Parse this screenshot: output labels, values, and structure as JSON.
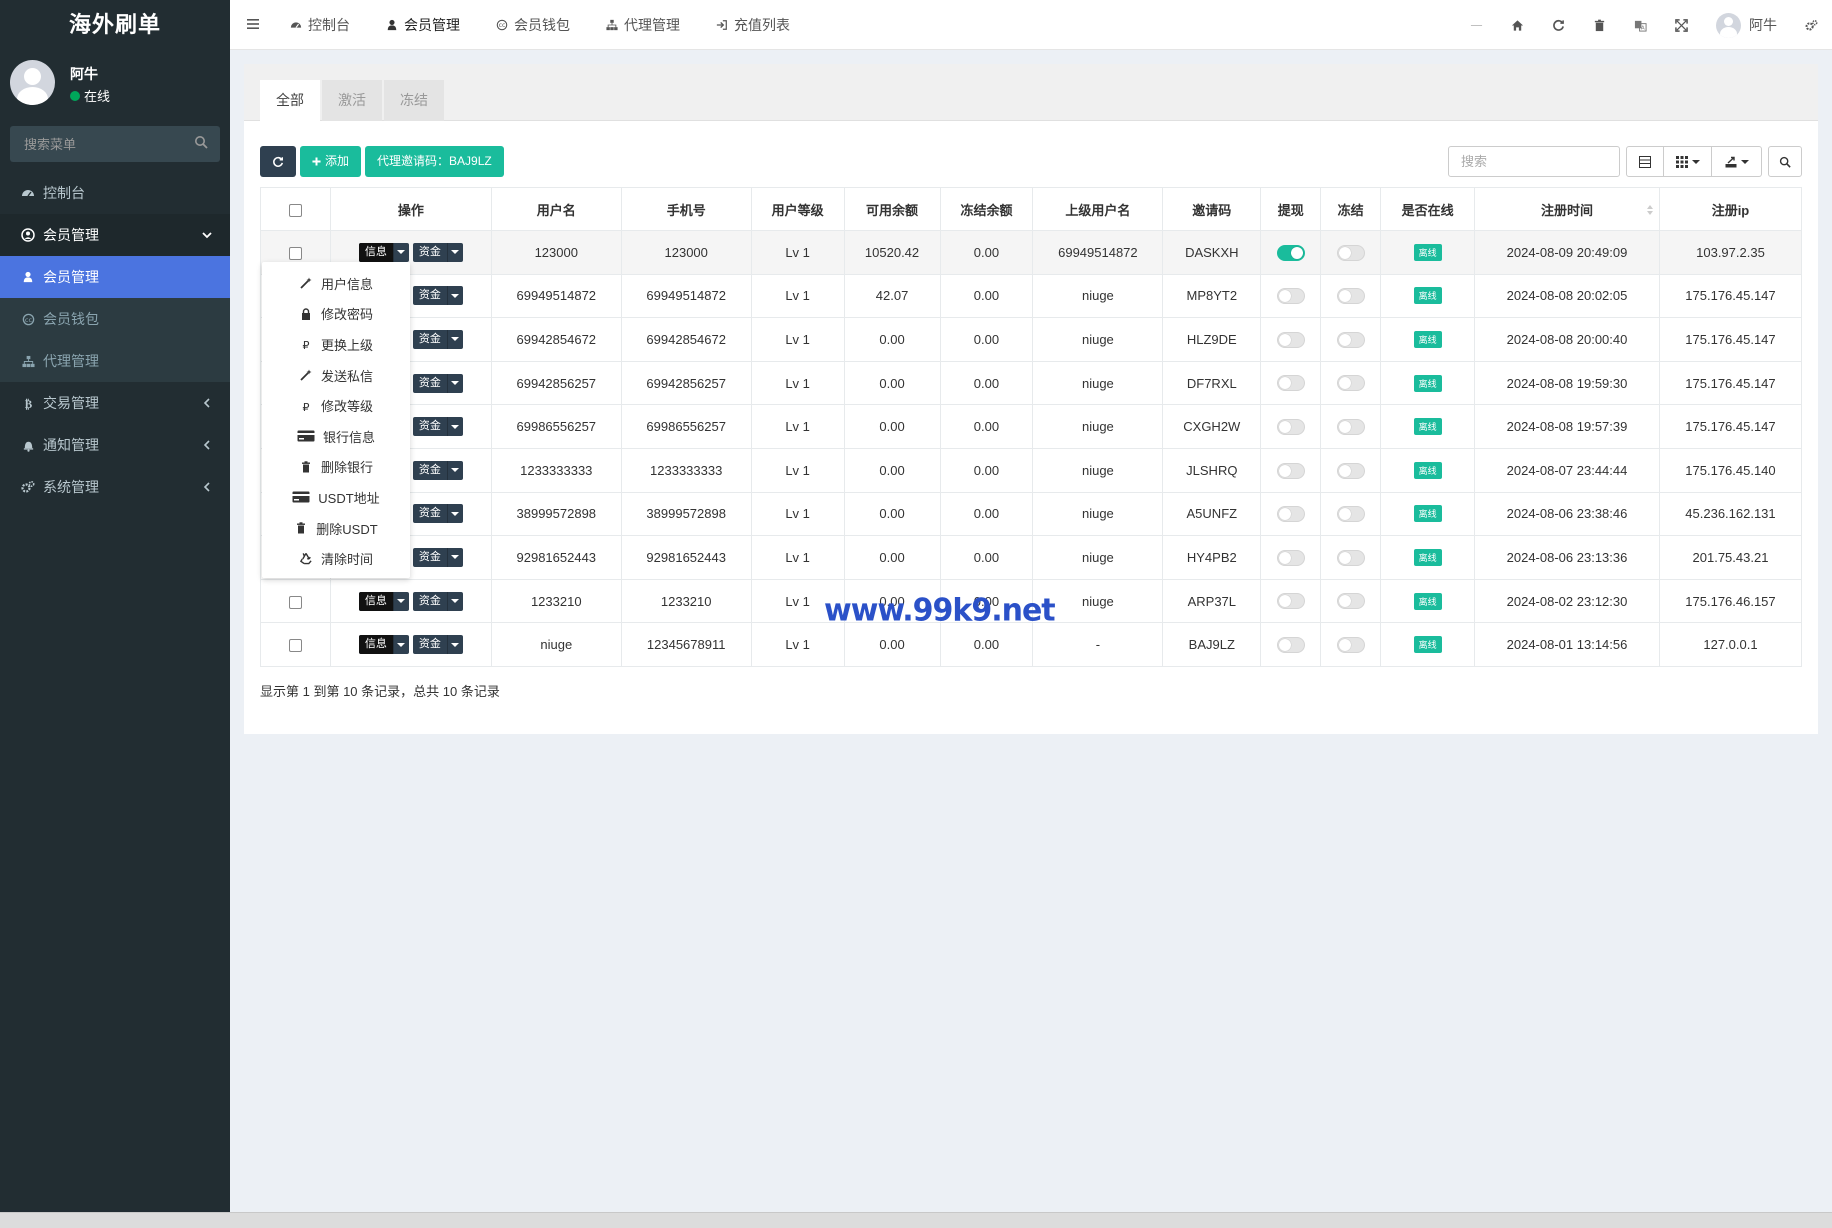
{
  "brand": "海外刷单",
  "user": {
    "name": "阿牛",
    "status": "在线"
  },
  "sidebar": {
    "search_placeholder": "搜索菜单",
    "items": [
      {
        "label": "控制台",
        "icon": "dashboard-icon"
      },
      {
        "label": "会员管理",
        "icon": "user-circle-icon",
        "open": true
      },
      {
        "label": "交易管理",
        "icon": "bitcoin-icon"
      },
      {
        "label": "通知管理",
        "icon": "bell-icon"
      },
      {
        "label": "系统管理",
        "icon": "cogs-icon"
      }
    ],
    "subitems": [
      {
        "label": "会员管理",
        "icon": "user-icon",
        "active": true
      },
      {
        "label": "会员钱包",
        "icon": "wallet-icon"
      },
      {
        "label": "代理管理",
        "icon": "sitemap-icon"
      }
    ]
  },
  "navbar": {
    "tabs": [
      {
        "label": "控制台",
        "icon": "dashboard-icon"
      },
      {
        "label": "会员管理",
        "icon": "user-icon"
      },
      {
        "label": "会员钱包",
        "icon": "wallet-icon"
      },
      {
        "label": "代理管理",
        "icon": "sitemap-icon"
      },
      {
        "label": "充值列表",
        "icon": "sign-in-icon"
      }
    ],
    "user_name": "阿牛"
  },
  "content_tabs": [
    "全部",
    "激活",
    "冻结"
  ],
  "toolbar": {
    "add_label": "添加",
    "invite_label": "代理邀请码：BAJ9LZ",
    "search_placeholder": "搜索"
  },
  "table": {
    "columns": [
      "操作",
      "用户名",
      "手机号",
      "用户等级",
      "可用余额",
      "冻结余额",
      "上级用户名",
      "邀请码",
      "提现",
      "冻结",
      "是否在线",
      "注册时间",
      "注册ip"
    ],
    "info_btn": "信息",
    "funds_btn": "资金",
    "online_badge": "离线",
    "rows": [
      {
        "username": "123000",
        "phone": "123000",
        "level": "Lv 1",
        "balance": "10520.42",
        "frozen": "0.00",
        "parent": "69949514872",
        "invite": "DASKXH",
        "withdraw": true,
        "freeze": false,
        "time": "2024-08-09 20:49:09",
        "ip": "103.97.2.35"
      },
      {
        "username": "69949514872",
        "phone": "69949514872",
        "level": "Lv 1",
        "balance": "42.07",
        "frozen": "0.00",
        "parent": "niuge",
        "invite": "MP8YT2",
        "withdraw": false,
        "freeze": false,
        "time": "2024-08-08 20:02:05",
        "ip": "175.176.45.147"
      },
      {
        "username": "69942854672",
        "phone": "69942854672",
        "level": "Lv 1",
        "balance": "0.00",
        "frozen": "0.00",
        "parent": "niuge",
        "invite": "HLZ9DE",
        "withdraw": false,
        "freeze": false,
        "time": "2024-08-08 20:00:40",
        "ip": "175.176.45.147"
      },
      {
        "username": "69942856257",
        "phone": "69942856257",
        "level": "Lv 1",
        "balance": "0.00",
        "frozen": "0.00",
        "parent": "niuge",
        "invite": "DF7RXL",
        "withdraw": false,
        "freeze": false,
        "time": "2024-08-08 19:59:30",
        "ip": "175.176.45.147"
      },
      {
        "username": "69986556257",
        "phone": "69986556257",
        "level": "Lv 1",
        "balance": "0.00",
        "frozen": "0.00",
        "parent": "niuge",
        "invite": "CXGH2W",
        "withdraw": false,
        "freeze": false,
        "time": "2024-08-08 19:57:39",
        "ip": "175.176.45.147"
      },
      {
        "username": "1233333333",
        "phone": "1233333333",
        "level": "Lv 1",
        "balance": "0.00",
        "frozen": "0.00",
        "parent": "niuge",
        "invite": "JLSHRQ",
        "withdraw": false,
        "freeze": false,
        "time": "2024-08-07 23:44:44",
        "ip": "175.176.45.140"
      },
      {
        "username": "38999572898",
        "phone": "38999572898",
        "level": "Lv 1",
        "balance": "0.00",
        "frozen": "0.00",
        "parent": "niuge",
        "invite": "A5UNFZ",
        "withdraw": false,
        "freeze": false,
        "time": "2024-08-06 23:38:46",
        "ip": "45.236.162.131"
      },
      {
        "username": "92981652443",
        "phone": "92981652443",
        "level": "Lv 1",
        "balance": "0.00",
        "frozen": "0.00",
        "parent": "niuge",
        "invite": "HY4PB2",
        "withdraw": false,
        "freeze": false,
        "time": "2024-08-06 23:13:36",
        "ip": "201.75.43.21"
      },
      {
        "username": "1233210",
        "phone": "1233210",
        "level": "Lv 1",
        "balance": "0.00",
        "frozen": "0.00",
        "parent": "niuge",
        "invite": "ARP37L",
        "withdraw": false,
        "freeze": false,
        "time": "2024-08-02 23:12:30",
        "ip": "175.176.46.157"
      },
      {
        "username": "niuge",
        "phone": "12345678911",
        "level": "Lv 1",
        "balance": "0.00",
        "frozen": "0.00",
        "parent": "-",
        "invite": "BAJ9LZ",
        "withdraw": false,
        "freeze": false,
        "time": "2024-08-01 13:14:56",
        "ip": "127.0.0.1"
      }
    ],
    "footer": "显示第 1 到第 10 条记录，总共 10 条记录"
  },
  "dropdown": {
    "items": [
      {
        "label": "用户信息",
        "icon": "magic-wand-icon"
      },
      {
        "label": "修改密码",
        "icon": "lock-icon"
      },
      {
        "label": "更换上级",
        "icon": "ruble-icon"
      },
      {
        "label": "发送私信",
        "icon": "magic-wand-icon"
      },
      {
        "label": "修改等级",
        "icon": "ruble-icon"
      },
      {
        "label": "银行信息",
        "icon": "credit-card-icon"
      },
      {
        "label": "删除银行",
        "icon": "trash-icon"
      },
      {
        "label": "USDT地址",
        "icon": "credit-card-icon"
      },
      {
        "label": "删除USDT",
        "icon": "trash-icon"
      },
      {
        "label": "清除时间",
        "icon": "recycle-icon"
      }
    ]
  },
  "watermark": "www.99k9.net",
  "colors": {
    "sidebar": "#222d32",
    "active": "#4b74e0",
    "accent": "#1abc9c",
    "dark_btn": "#2f4050"
  }
}
